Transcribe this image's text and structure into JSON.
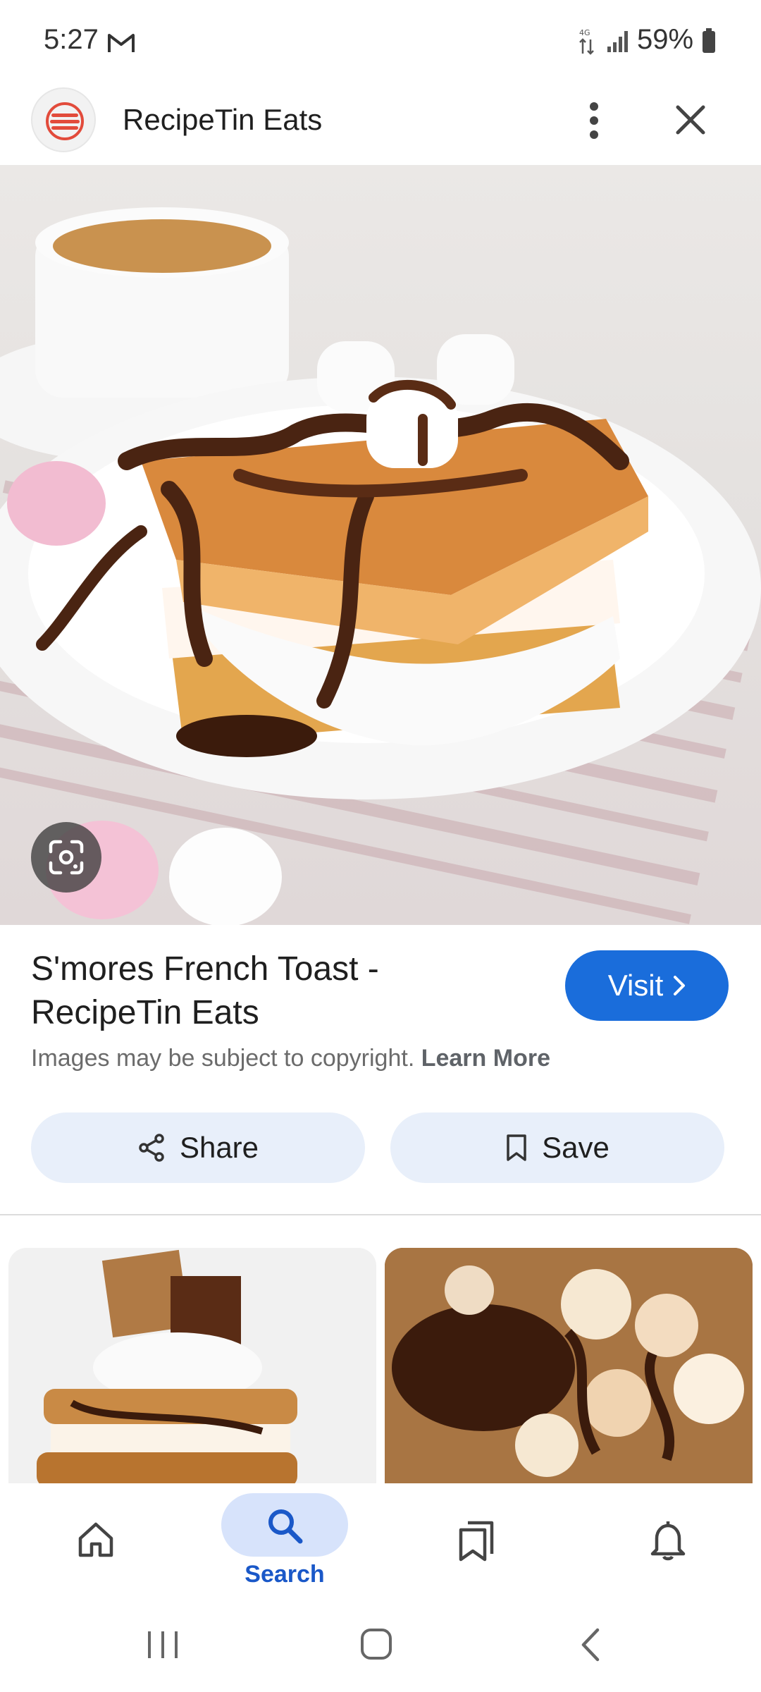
{
  "status_bar": {
    "time": "5:27",
    "battery": "59%",
    "icons": [
      "gmail-icon",
      "lte-data-icon",
      "signal-icon",
      "battery-icon"
    ]
  },
  "header": {
    "site_name": "RecipeTin Eats",
    "logo_icon": "recipetin-logo-icon",
    "menu_icon": "more-vert-icon",
    "close_icon": "close-icon"
  },
  "result": {
    "title": "S'mores French Toast - RecipeTin Eats",
    "visit_label": "Visit",
    "copyright_text": "Images may be subject to copyright.",
    "learn_more": "Learn More",
    "share_label": "Share",
    "save_label": "Save"
  },
  "bottom_nav": {
    "items": [
      {
        "name": "home",
        "icon": "home-icon",
        "label": ""
      },
      {
        "name": "search",
        "icon": "search-icon",
        "label": "Search",
        "active": true
      },
      {
        "name": "saved",
        "icon": "collections-icon",
        "label": ""
      },
      {
        "name": "notifications",
        "icon": "bell-icon",
        "label": ""
      }
    ]
  },
  "colors": {
    "accent": "#1a6ddb",
    "pill_bg": "#e8effa",
    "active_nav": "#d7e3fb",
    "logo_red": "#e24b3b"
  }
}
